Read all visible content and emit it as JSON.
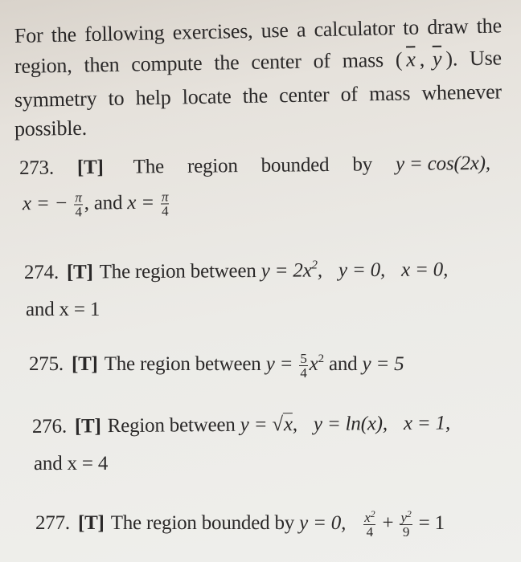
{
  "intro": {
    "line1": [
      "For",
      "the",
      "following",
      "exercises,",
      "use",
      "a",
      "calculator",
      "to",
      "draw",
      "the"
    ],
    "line2_words": [
      "region,",
      "then",
      "compute",
      "the",
      "center",
      "of",
      "mass"
    ],
    "line2_xbar": "x",
    "line2_ybar": "y",
    "line2_end": "Use",
    "line3": [
      "symmetry",
      "to",
      "help",
      "locate",
      "the",
      "center",
      "of",
      "mass",
      "whenever"
    ],
    "line4": "possible."
  },
  "exercises": [
    {
      "number": "273.",
      "tag": "[T]",
      "text_words": [
        "The",
        "region",
        "bounded",
        "by"
      ],
      "equation": "y = cos(2x),",
      "cont": {
        "x_left": "x = −",
        "frac1_num": "π",
        "frac1_den": "4",
        "mid": ", and ",
        "x_right": "x = ",
        "frac2_num": "π",
        "frac2_den": "4"
      }
    },
    {
      "number": "274.",
      "tag": "[T]",
      "text": "The region between",
      "eq1_base": "y = 2x",
      "eq1_exp": "2",
      "eq1_end": ",",
      "eq2": "y = 0,",
      "eq3": "x = 0,",
      "cont": "and x = 1"
    },
    {
      "number": "275.",
      "tag": "[T]",
      "text": "The region between",
      "eq_left": "y = ",
      "frac_num": "5",
      "frac_den": "4",
      "eq_var": "x",
      "eq_exp": "2",
      "mid": " and ",
      "eq_right": "y = 5"
    },
    {
      "number": "276.",
      "tag": "[T]",
      "text": "Region between",
      "eq1_left": "y = ",
      "eq1_sqrt_sym": "√",
      "eq1_radicand": "x",
      "eq1_end": ",",
      "eq2": "y = ln(x),",
      "eq3": "x = 1,",
      "cont": "and x = 4"
    },
    {
      "number": "277.",
      "tag": "[T]",
      "text": "The region bounded by",
      "eq1": "y = 0,",
      "f1_num_var": "x",
      "f1_num_exp": "2",
      "f1_den": "4",
      "plus": "+",
      "f2_num_var": "y",
      "f2_num_exp": "2",
      "f2_den": "9",
      "eq_end": "= 1"
    }
  ]
}
